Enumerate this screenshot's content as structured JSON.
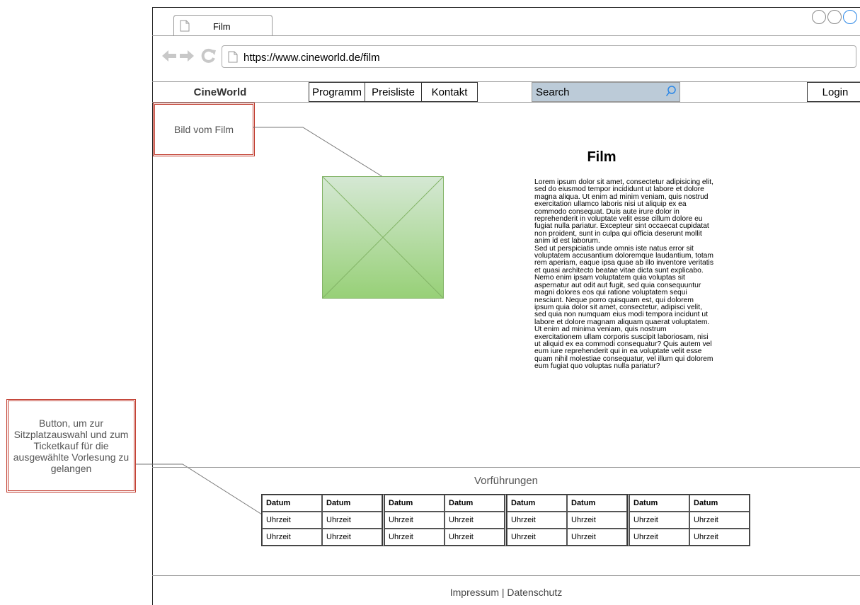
{
  "browser": {
    "tab_title": "Film",
    "url": "https://www.cineworld.de/film"
  },
  "nav": {
    "brand": "CineWorld",
    "items": [
      "Programm",
      "Preisliste",
      "Kontakt"
    ],
    "search_placeholder": "Search",
    "login": "Login"
  },
  "annotations": {
    "image_note": "Bild vom Film",
    "button_note": "Button, um zur Sitzplatzauswahl  und zum Ticketkauf für die ausgewählte Vorlesung zu gelangen"
  },
  "film": {
    "title": "Film",
    "paragraphs": [
      "Lorem ipsum dolor sit amet, consectetur adipisicing elit, sed do eiusmod tempor incididunt ut labore et dolore magna aliqua. Ut enim ad minim veniam, quis nostrud exercitation ullamco laboris nisi ut aliquip ex ea commodo consequat. Duis aute irure dolor in reprehenderit in voluptate velit esse cillum dolore eu fugiat nulla pariatur. Excepteur sint occaecat cupidatat non proident, sunt in culpa qui officia deserunt mollit anim id est laborum.",
      "Sed ut perspiciatis unde omnis iste natus error sit voluptatem accusantium doloremque laudantium, totam rem aperiam, eaque ipsa quae ab illo inventore veritatis et quasi architecto beatae vitae dicta sunt explicabo. Nemo enim ipsam voluptatem quia voluptas sit aspernatur aut odit aut fugit, sed quia consequuntur magni dolores eos qui ratione voluptatem sequi nesciunt. Neque porro quisquam est, qui dolorem ipsum quia dolor sit amet, consectetur, adipisci velit, sed quia non numquam eius modi tempora incidunt ut labore et dolore magnam aliquam quaerat voluptatem. Ut enim ad minima veniam, quis nostrum exercitationem ullam corporis suscipit laboriosam, nisi ut aliquid ex ea commodi consequatur? Quis autem vel eum iure reprehenderit qui in ea voluptate velit esse quam nihil molestiae consequatur, vel illum qui dolorem eum fugiat quo voluptas nulla pariatur?"
    ]
  },
  "showings": {
    "title": "Vorführungen",
    "groups": [
      {
        "headers": [
          "Datum",
          "Datum"
        ],
        "rows": [
          [
            "Uhrzeit",
            "Uhrzeit"
          ],
          [
            "Uhrzeit",
            "Uhrzeit"
          ]
        ]
      },
      {
        "headers": [
          "Datum",
          "Datum"
        ],
        "rows": [
          [
            "Uhrzeit",
            "Uhrzeit"
          ],
          [
            "Uhrzeit",
            "Uhrzeit"
          ]
        ]
      },
      {
        "headers": [
          "Datum",
          "Datum"
        ],
        "rows": [
          [
            "Uhrzeit",
            "Uhrzeit"
          ],
          [
            "Uhrzeit",
            "Uhrzeit"
          ]
        ]
      },
      {
        "headers": [
          "Datum",
          "Datum"
        ],
        "rows": [
          [
            "Uhrzeit",
            "Uhrzeit"
          ],
          [
            "Uhrzeit",
            "Uhrzeit"
          ]
        ]
      }
    ]
  },
  "footer": {
    "text": "Impressum | Datenschutz"
  },
  "colors": {
    "search_bg": "#bccbd8",
    "annotation_border": "#c0392b",
    "image_placeholder": "#97d077"
  }
}
